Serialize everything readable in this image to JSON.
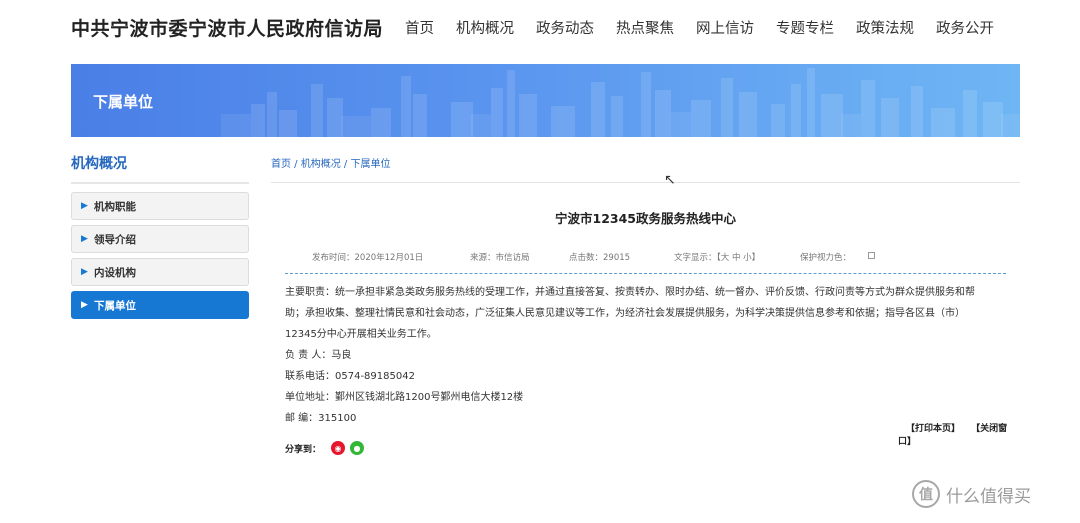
{
  "header": {
    "site_title": "中共宁波市委宁波市人民政府信访局",
    "nav": [
      "首页",
      "机构概况",
      "政务动态",
      "热点聚焦",
      "网上信访",
      "专题专栏",
      "政策法规",
      "政务公开"
    ]
  },
  "banner": {
    "title": "下属单位"
  },
  "sidebar": {
    "title": "机构概况",
    "items": [
      {
        "label": "机构职能"
      },
      {
        "label": "领导介绍"
      },
      {
        "label": "内设机构"
      },
      {
        "label": "下属单位"
      }
    ],
    "active_index": 3
  },
  "breadcrumb": {
    "home": "首页",
    "level1": "机构概况",
    "level2": "下属单位",
    "sep": " / "
  },
  "article": {
    "title": "宁波市12345政务服务热线中心",
    "meta": {
      "published": "发布时间：2020年12月01日",
      "source": "来源：市信访局",
      "views": "点击数：29015",
      "font_size": "文字显示：【大 中 小】",
      "eye_protection": "保护视力色："
    },
    "swatch_colors": [
      "#fadfc8",
      "#f5e7c6",
      "#e2f0d6",
      "#d3ecec",
      "#dbe3f5",
      "#e2dcf2",
      "#ffffff"
    ],
    "content": {
      "duties_line1": "主要职责：统一承担非紧急类政务服务热线的受理工作，并通过直接答复、按责转办、限时办结、统一督办、评价反馈、行政问责等方式为群众提供服务和帮",
      "duties_line2": "助；承担收集、整理社情民意和社会动态，广泛征集人民意见建议等工作，为经济社会发展提供服务，为科学决策提供信息参考和依据；指导各区县（市）",
      "duties_line3": "12345分中心开展相关业务工作。",
      "person": "负  责  人：马良",
      "phone": "联系电话：0574-89185042",
      "address": "单位地址：鄞州区钱湖北路1200号鄞州电信大楼12楼",
      "postcode": "邮        编：315100"
    },
    "actions": {
      "print": "【打印本页】",
      "close": "【关闭窗口】"
    },
    "share": {
      "label": "分享到："
    }
  },
  "watermark": {
    "text": "什么值得买",
    "logo": "值"
  }
}
